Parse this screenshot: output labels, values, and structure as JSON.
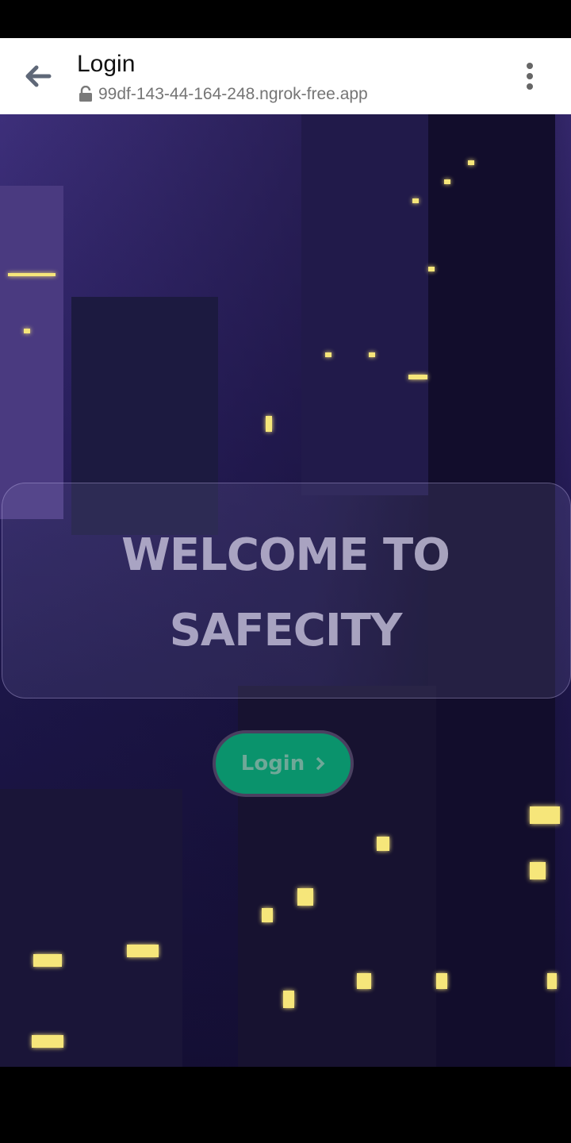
{
  "toolbar": {
    "title": "Login",
    "url": "99df-143-44-164-248.ngrok-free.app",
    "back_icon": "arrow-left-icon",
    "lock_icon": "lock-icon",
    "menu_icon": "more-vert-icon"
  },
  "hero": {
    "welcome_line1": "WELCOME TO",
    "welcome_line2": "SAFECITY",
    "login_label": "Login",
    "login_icon": "chevron-right-icon",
    "accent": "#0a936c"
  }
}
